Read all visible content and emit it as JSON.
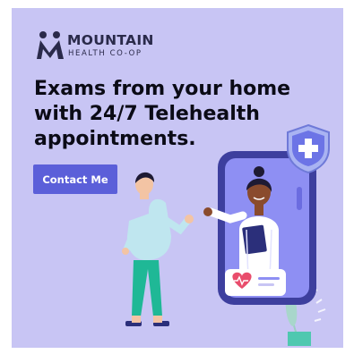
{
  "brand": {
    "name_line1": "MOUNTAIN",
    "name_line2": "HEALTH CO-OP"
  },
  "headline": {
    "line1": "Exams from your home",
    "line2": "with 24/7 Telehealth",
    "line3": "appointments."
  },
  "cta": {
    "label": "Contact Me"
  },
  "colors": {
    "background": "#c8c5f4",
    "button": "#5b5fd9",
    "phone_frame": "#3d3f9e",
    "doctor_coat": "#ffffff",
    "patient_shirt": "#bfe6ef",
    "patient_pants": "#1fb896",
    "heart": "#e94d6c",
    "plant": "#b9dfd6"
  }
}
